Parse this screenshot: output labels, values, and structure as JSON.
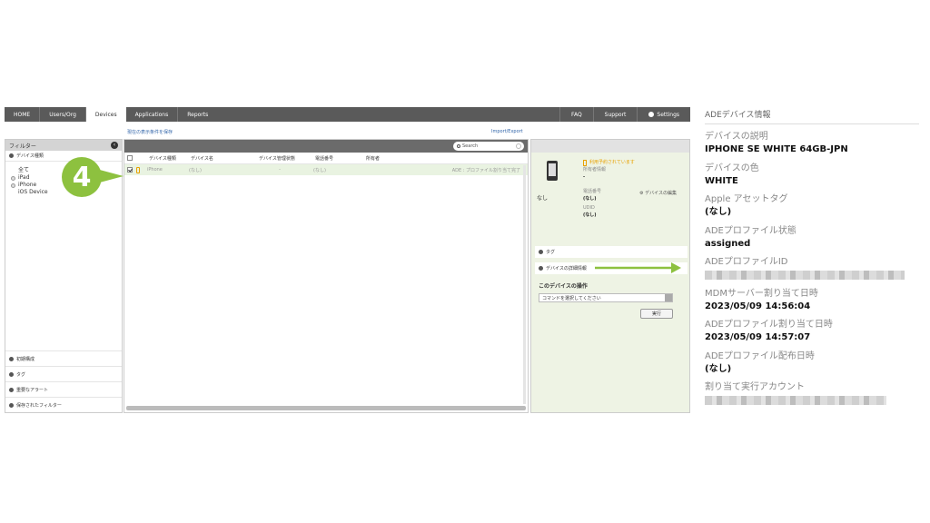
{
  "nav": {
    "tabs": [
      "HOME",
      "Users/Org",
      "Devices",
      "Applications",
      "Reports"
    ],
    "active_tab": "Devices",
    "right": [
      "FAQ",
      "Support",
      "Settings"
    ]
  },
  "links": {
    "save_filter": "現在の表示条件を保存",
    "import_export": "Import/Export"
  },
  "left_panel": {
    "title": "フィルター",
    "device_type_header": "デバイス種類",
    "filters": [
      "全て",
      "iPad",
      "iPhone",
      "iOS Device"
    ],
    "bottom_sections": [
      "初期構成",
      "タグ",
      "重要なアラート",
      "保存されたフィルター"
    ]
  },
  "center_panel": {
    "search_placeholder": "Search",
    "columns": [
      "デバイス種類",
      "デバイス名",
      "デバイス管理状態",
      "電話番号",
      "所有者"
    ],
    "rows": [
      {
        "type": "iPhone",
        "name": "(なし)",
        "mgmt": "-",
        "tel": "(なし)",
        "owner": "",
        "status": "ADE : プロファイル割り当て完了"
      }
    ]
  },
  "right_panel": {
    "device_label": "なし",
    "availability": "利用予約されています",
    "owner_info_label": "所有者情報",
    "owner_info_value": "-",
    "tel_label": "電話番号",
    "tel_value": "(なし)",
    "udid_label": "UDID",
    "udid_value": "(なし)",
    "edit_link": "デバイスの編集",
    "tag_section": "タグ",
    "details_section": "デバイスの詳細情報",
    "ops_title": "このデバイスの操作",
    "command_placeholder": "コマンドを選択してください",
    "run_button": "実行"
  },
  "step_badge": "4",
  "info_panel": {
    "title": "ADEデバイス情報",
    "fields": [
      {
        "label": "デバイスの説明",
        "value": "IPHONE SE WHITE 64GB-JPN"
      },
      {
        "label": "デバイスの色",
        "value": "WHITE"
      },
      {
        "label": "Apple アセットタグ",
        "value": "(なし)"
      },
      {
        "label": "ADEプロファイル状態",
        "value": "assigned"
      },
      {
        "label": "ADEプロファイルID",
        "value": ""
      },
      {
        "label": "MDMサーバー割り当て日時",
        "value": "2023/05/09 14:56:04"
      },
      {
        "label": "ADEプロファイル割り当て日時",
        "value": "2023/05/09 14:57:07"
      },
      {
        "label": "ADEプロファイル配布日時",
        "value": "(なし)"
      },
      {
        "label": "割り当て実行アカウント",
        "value": ""
      }
    ]
  },
  "colors": {
    "nav_bg": "#5a5a5a",
    "accent_green": "#8dc13f",
    "selected_row": "#e9f3e1",
    "link_blue": "#3366aa",
    "warning_orange": "#e8a100"
  }
}
